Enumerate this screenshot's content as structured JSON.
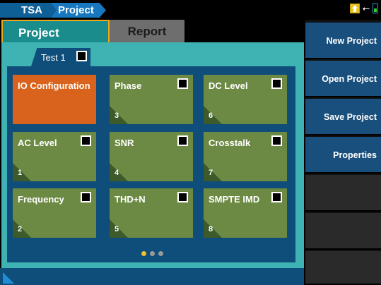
{
  "breadcrumb": [
    "TSA",
    "Project"
  ],
  "tabs": {
    "project": "Project",
    "report": "Report"
  },
  "test": {
    "label": "Test 1",
    "checked": false
  },
  "tiles": [
    {
      "label": "IO Configuration",
      "number": "",
      "checkbox": false,
      "active": true
    },
    {
      "label": "Phase",
      "number": "3",
      "checkbox": true
    },
    {
      "label": "DC Level",
      "number": "6",
      "checkbox": true
    },
    {
      "label": "AC Level",
      "number": "1",
      "checkbox": true
    },
    {
      "label": "SNR",
      "number": "4",
      "checkbox": true
    },
    {
      "label": "Crosstalk",
      "number": "7",
      "checkbox": true
    },
    {
      "label": "Frequency",
      "number": "2",
      "checkbox": true
    },
    {
      "label": "THD+N",
      "number": "5",
      "checkbox": true
    },
    {
      "label": "SMPTE IMD",
      "number": "8",
      "checkbox": true
    }
  ],
  "pager": {
    "pages": 3,
    "current": 1
  },
  "side_menu": [
    {
      "label": "New Project"
    },
    {
      "label": "Open Project"
    },
    {
      "label": "Save Project"
    },
    {
      "label": "Properties"
    },
    {
      "label": ""
    },
    {
      "label": ""
    },
    {
      "label": ""
    }
  ],
  "status_icons": [
    "home-icon",
    "usb-icon",
    "battery-icon"
  ],
  "colors": {
    "accent_orange": "#d9621c",
    "tile_green": "#6d8a44",
    "panel_teal": "#3fb3b3",
    "navy": "#0f4d7a",
    "tab_border": "#f0a818"
  }
}
